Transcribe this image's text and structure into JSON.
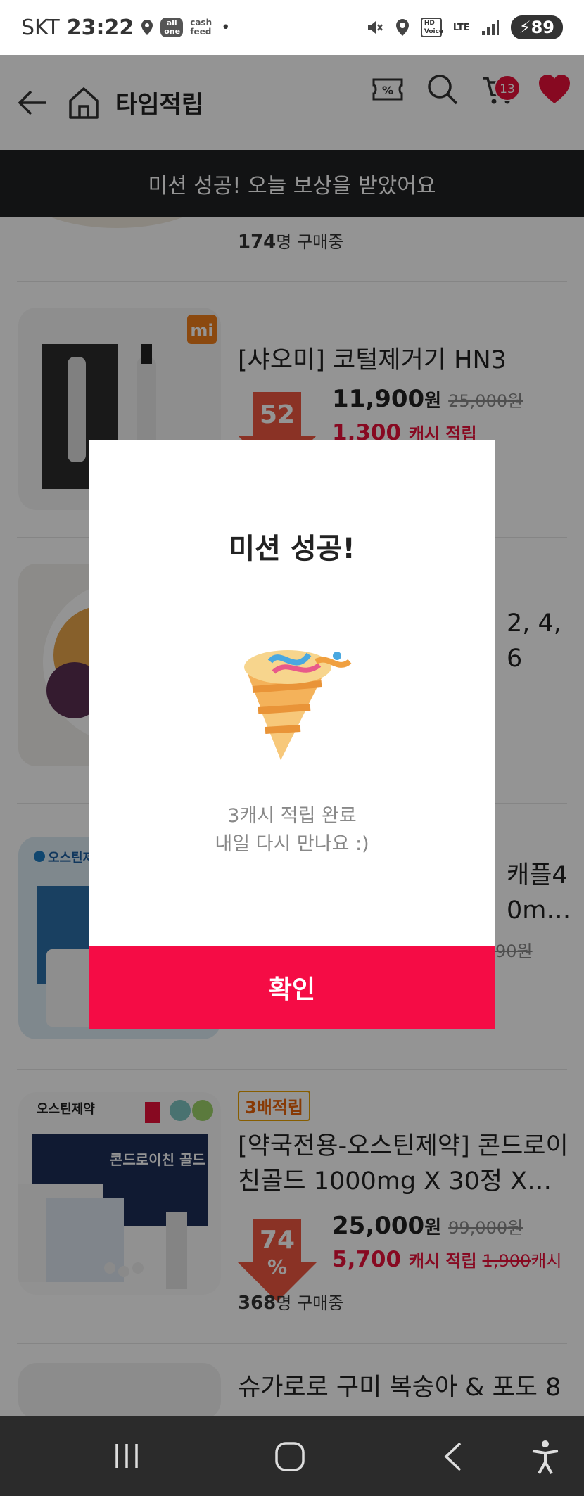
{
  "status_bar": {
    "carrier": "SKT",
    "time": "23:22",
    "app_pill": "all one",
    "cashfeed": "cash feed",
    "hd": "HD Voice",
    "lte": "LTE",
    "battery": "89"
  },
  "header": {
    "title": "타임적립",
    "cart_count": "13"
  },
  "toast": {
    "text": "미션 성공! 오늘 보상을 받았어요"
  },
  "products": [
    {
      "buyers_count": "174",
      "buyers_suffix": "명 구매중"
    },
    {
      "name": "[샤오미] 코털제거기 HN3",
      "price": "11,900",
      "won": "원",
      "orig_price": "25,000",
      "discount": "52",
      "cash": "1,300",
      "cash_label": "캐시 적립",
      "brand_logo": "mi"
    },
    {
      "name_tail": "2, 4, 6"
    },
    {
      "name_tail_1": "캐플4",
      "name_tail_2": "0m…",
      "orig_tail": "90원",
      "brand": "오스틴제약"
    },
    {
      "badge": "3배적립",
      "name": "[약국전용-오스틴제약] 콘드로이친골드 1000mg X 30정 X…",
      "price": "25,000",
      "won": "원",
      "orig_price": "99,000",
      "discount": "74",
      "cash": "5,700",
      "cash_label": "캐시 적립",
      "orig_cash": "1,900",
      "cash_unit": "캐시",
      "buyers_count": "368",
      "buyers_suffix": "명 구매중",
      "brand": "오스틴제약",
      "product_text": "콘드로이친 골드"
    },
    {
      "name": "슈가로로 구미 복숭아 & 포도 8"
    }
  ],
  "modal": {
    "title": "미션 성공!",
    "illustration": "party-popper-icon",
    "message_line1": "3캐시 적립 완료",
    "message_line2": "내일 다시 만나요 :)",
    "confirm": "확인"
  },
  "colors": {
    "accent": "#f50c45",
    "discount_red": "#e8113a",
    "toast_bg": "#202124"
  }
}
